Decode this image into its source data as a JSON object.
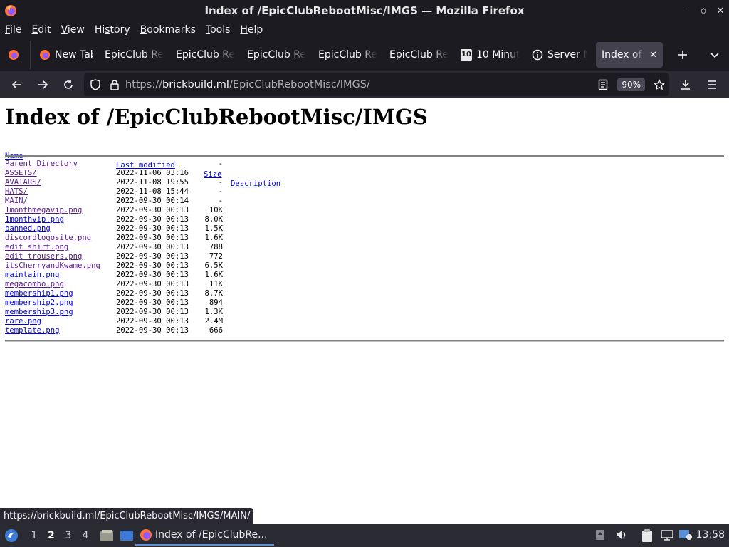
{
  "window": {
    "title": "Index of /EpicClubRebootMisc/IMGS — Mozilla Firefox",
    "controls": [
      "–",
      "⬦",
      "✕"
    ]
  },
  "menubar": {
    "items": [
      {
        "label": "File",
        "key": "F",
        "rest": "ile"
      },
      {
        "label": "Edit",
        "key": "E",
        "rest": "dit"
      },
      {
        "label": "View",
        "key": "V",
        "rest": "iew"
      },
      {
        "label": "History",
        "key": "",
        "pre": "Hi",
        "mid": "s",
        "post": "tory"
      },
      {
        "label": "Bookmarks",
        "key": "B",
        "rest": "ookmarks"
      },
      {
        "label": "Tools",
        "key": "T",
        "rest": "ools"
      },
      {
        "label": "Help",
        "key": "H",
        "rest": "elp"
      }
    ]
  },
  "tabs": [
    {
      "label": "New Tab",
      "icon": "firefox-icon"
    },
    {
      "label": "EpicClub Re",
      "icon": ""
    },
    {
      "label": "EpicClub Re",
      "icon": ""
    },
    {
      "label": "EpicClub Re",
      "icon": ""
    },
    {
      "label": "EpicClub Re",
      "icon": ""
    },
    {
      "label": "EpicClub Re",
      "icon": ""
    },
    {
      "label": "10 Minut",
      "icon": "ten-minute-mail-icon"
    },
    {
      "label": "Server M",
      "icon": "info-icon"
    },
    {
      "label": "Index of /",
      "icon": "",
      "active": true
    }
  ],
  "navbar": {
    "url_scheme": "https://",
    "url_host": "brickbuild.ml",
    "url_path": "/EpicClubRebootMisc/IMGS/",
    "zoom": "90%"
  },
  "page": {
    "heading": "Index of /EpicClubRebootMisc/IMGS",
    "columns": {
      "name": "Name",
      "modified": "Last modified",
      "size": "Size",
      "description": "Description"
    },
    "rows": [
      {
        "name": "Parent Directory",
        "date": "",
        "size": "-",
        "visited": true
      },
      {
        "name": "ASSETS/",
        "date": "2022-11-06 03:16",
        "size": "-",
        "visited": true
      },
      {
        "name": "AVATARS/",
        "date": "2022-11-08 19:55",
        "size": "-",
        "visited": true
      },
      {
        "name": "HATS/",
        "date": "2022-11-08 15:44",
        "size": "-",
        "visited": true
      },
      {
        "name": "MAIN/",
        "date": "2022-09-30 00:14",
        "size": "-",
        "visited": true
      },
      {
        "name": "1monthmegavip.png",
        "date": "2022-09-30 00:13",
        "size": "10K",
        "visited": true
      },
      {
        "name": "1monthvip.png",
        "date": "2022-09-30 00:13",
        "size": "8.0K",
        "visited": false
      },
      {
        "name": "banned.png",
        "date": "2022-09-30 00:13",
        "size": "1.5K",
        "visited": false
      },
      {
        "name": "discordlogosite.png",
        "date": "2022-09-30 00:13",
        "size": "1.6K",
        "visited": true
      },
      {
        "name": "edit shirt.png",
        "date": "2022-09-30 00:13",
        "size": "788",
        "visited": true
      },
      {
        "name": "edit trousers.png",
        "date": "2022-09-30 00:13",
        "size": "772",
        "visited": true
      },
      {
        "name": "itsCherryandKwame.png",
        "date": "2022-09-30 00:13",
        "size": "6.5K",
        "visited": true
      },
      {
        "name": "maintain.png",
        "date": "2022-09-30 00:13",
        "size": "1.6K",
        "visited": false
      },
      {
        "name": "megacombo.png",
        "date": "2022-09-30 00:13",
        "size": "11K",
        "visited": true
      },
      {
        "name": "membership1.png",
        "date": "2022-09-30 00:13",
        "size": "8.7K",
        "visited": false
      },
      {
        "name": "membership2.png",
        "date": "2022-09-30 00:13",
        "size": "894",
        "visited": false
      },
      {
        "name": "membership3.png",
        "date": "2022-09-30 00:13",
        "size": "1.3K",
        "visited": false
      },
      {
        "name": "rare.png",
        "date": "2022-09-30 00:13",
        "size": "2.4M",
        "visited": false
      },
      {
        "name": "template.png",
        "date": "2022-09-30 00:13",
        "size": "666",
        "visited": false
      }
    ]
  },
  "status_url": "https://brickbuild.ml/EpicClubRebootMisc/IMGS/MAIN/",
  "taskbar": {
    "workspaces": [
      "1",
      "2",
      "3",
      "4"
    ],
    "active_workspace": "2",
    "task_label": "Index of /EpicClubRe...",
    "clock": "13:58"
  },
  "colors": {
    "link": "#0000ee",
    "visited": "#551a8b",
    "chrome_dark": "#1c1b22",
    "toolbar": "#2b2a33",
    "accent": "#5a8fd6"
  }
}
